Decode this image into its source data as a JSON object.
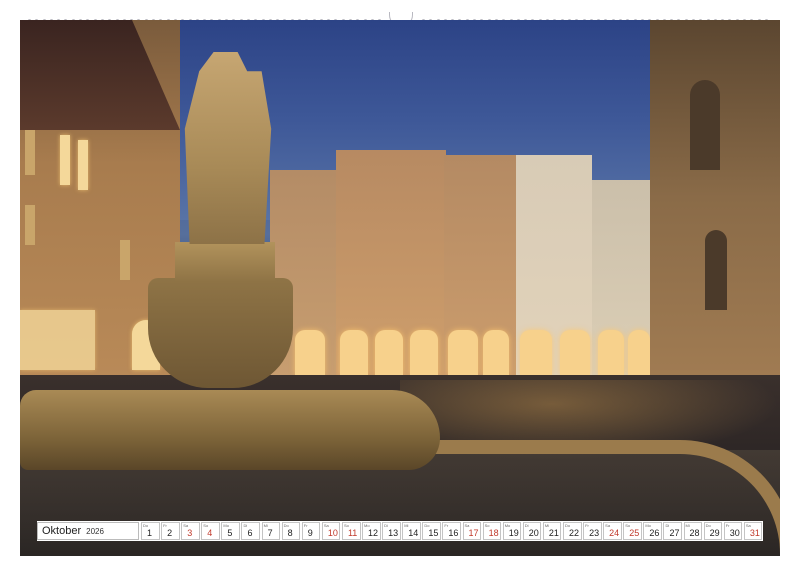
{
  "calendar": {
    "month": "Oktober",
    "year": "2026",
    "days": [
      {
        "n": "1",
        "wd": "Do"
      },
      {
        "n": "2",
        "wd": "Fr"
      },
      {
        "n": "3",
        "wd": "Sa"
      },
      {
        "n": "4",
        "wd": "So"
      },
      {
        "n": "5",
        "wd": "Mo"
      },
      {
        "n": "6",
        "wd": "Di"
      },
      {
        "n": "7",
        "wd": "Mi"
      },
      {
        "n": "8",
        "wd": "Do"
      },
      {
        "n": "9",
        "wd": "Fr"
      },
      {
        "n": "10",
        "wd": "Sa"
      },
      {
        "n": "11",
        "wd": "So"
      },
      {
        "n": "12",
        "wd": "Mo"
      },
      {
        "n": "13",
        "wd": "Di"
      },
      {
        "n": "14",
        "wd": "Mi"
      },
      {
        "n": "15",
        "wd": "Do"
      },
      {
        "n": "16",
        "wd": "Fr"
      },
      {
        "n": "17",
        "wd": "Sa"
      },
      {
        "n": "18",
        "wd": "So"
      },
      {
        "n": "19",
        "wd": "Mo"
      },
      {
        "n": "20",
        "wd": "Di"
      },
      {
        "n": "21",
        "wd": "Mi"
      },
      {
        "n": "22",
        "wd": "Do"
      },
      {
        "n": "23",
        "wd": "Fr"
      },
      {
        "n": "24",
        "wd": "Sa"
      },
      {
        "n": "25",
        "wd": "So"
      },
      {
        "n": "26",
        "wd": "Mo"
      },
      {
        "n": "27",
        "wd": "Di"
      },
      {
        "n": "28",
        "wd": "Mi"
      },
      {
        "n": "29",
        "wd": "Do"
      },
      {
        "n": "30",
        "wd": "Fr"
      },
      {
        "n": "31",
        "wd": "Sa"
      }
    ],
    "highlight_color": "#c0392b"
  },
  "photo": {
    "sky_color": "#3e5898",
    "light_color": "#f4d89a"
  }
}
